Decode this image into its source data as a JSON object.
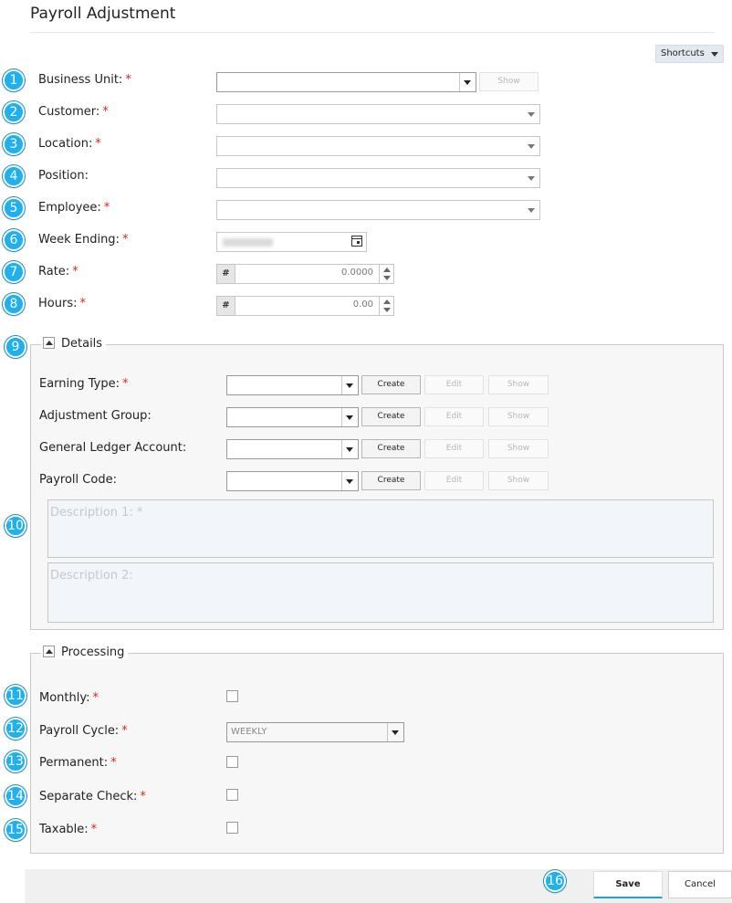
{
  "page": {
    "title": "Payroll Adjustment"
  },
  "shortcuts": {
    "label": "Shortcuts"
  },
  "colors": {
    "badge": "#1fb0ef",
    "required": "#e0221b",
    "save_accent": "#1f9fe0"
  },
  "badges": [
    "1",
    "2",
    "3",
    "4",
    "5",
    "6",
    "7",
    "8",
    "9",
    "10",
    "11",
    "12",
    "13",
    "14",
    "15",
    "16"
  ],
  "fields": {
    "business_unit": {
      "label": "Business Unit:",
      "required": "*",
      "show": "Show"
    },
    "customer": {
      "label": "Customer:",
      "required": "*"
    },
    "location": {
      "label": "Location:",
      "required": "*"
    },
    "position": {
      "label": "Position:"
    },
    "employee": {
      "label": "Employee:",
      "required": "*"
    },
    "week_ending": {
      "label": "Week Ending:",
      "required": "*"
    },
    "rate": {
      "label": "Rate:",
      "required": "*",
      "prefix": "#",
      "value": "0.0000"
    },
    "hours": {
      "label": "Hours:",
      "required": "*",
      "prefix": "#",
      "value": "0.00"
    }
  },
  "details": {
    "legend": "Details",
    "rows": [
      {
        "label": "Earning Type:",
        "required": "*",
        "create": "Create",
        "edit": "Edit",
        "show": "Show"
      },
      {
        "label": "Adjustment Group:",
        "required": "",
        "create": "Create",
        "edit": "Edit",
        "show": "Show"
      },
      {
        "label": "General Ledger Account:",
        "required": "",
        "create": "Create",
        "edit": "Edit",
        "show": "Show"
      },
      {
        "label": "Payroll Code:",
        "required": "",
        "create": "Create",
        "edit": "Edit",
        "show": "Show"
      }
    ],
    "description1_placeholder": "Description 1: *",
    "description2_placeholder": "Description 2:"
  },
  "processing": {
    "legend": "Processing",
    "monthly": {
      "label": "Monthly:",
      "required": "*",
      "checked": false
    },
    "payroll_cycle": {
      "label": "Payroll Cycle:",
      "required": "*",
      "value": "WEEKLY"
    },
    "permanent": {
      "label": "Permanent:",
      "required": "*",
      "checked": false
    },
    "separate_check": {
      "label": "Separate Check:",
      "required": "*",
      "checked": false
    },
    "taxable": {
      "label": "Taxable:",
      "required": "*",
      "checked": false
    }
  },
  "footer": {
    "save": "Save",
    "cancel": "Cancel"
  }
}
